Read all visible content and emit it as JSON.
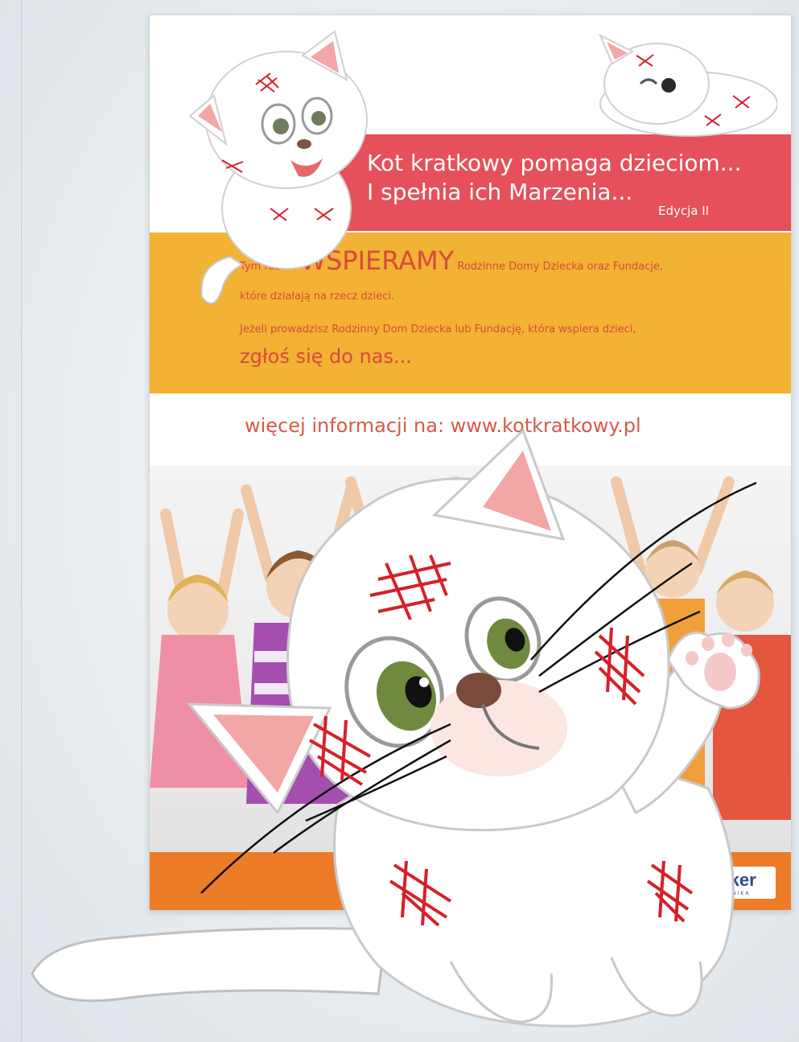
{
  "poster": {
    "headline_line1": "Kot kratkowy pomaga dzieciom...",
    "headline_line2": "I spełnia ich Marzenia...",
    "edition": "Edycja II",
    "support_prefix": "Tym razem",
    "support_keyword": "WSPIERAMY",
    "support_suffix": "Rodzinne Domy Dziecka oraz Fundacje,",
    "support_line2": "które działają na rzecz dzieci.",
    "apply_line1": "Jeżeli prowadzisz Rodzinny Dom Dziecka lub Fundację, która wspiera dzieci,",
    "apply_line2": "zgłoś się do nas...",
    "more_info": "więcej informacji na: www.kotkratkowy.pl",
    "logo_text": "ocker",
    "logo_subtext": "TECHNIKA"
  },
  "colors": {
    "pink_band": "#e6505a",
    "yellow_band": "#f2b234",
    "orange_footer": "#ec7c28",
    "text_red": "#d84a3b",
    "cat_stitch_red": "#d6202a"
  },
  "icons": [
    "mascot-cat-icon",
    "sitting-cat-icon",
    "lying-cat-icon"
  ]
}
